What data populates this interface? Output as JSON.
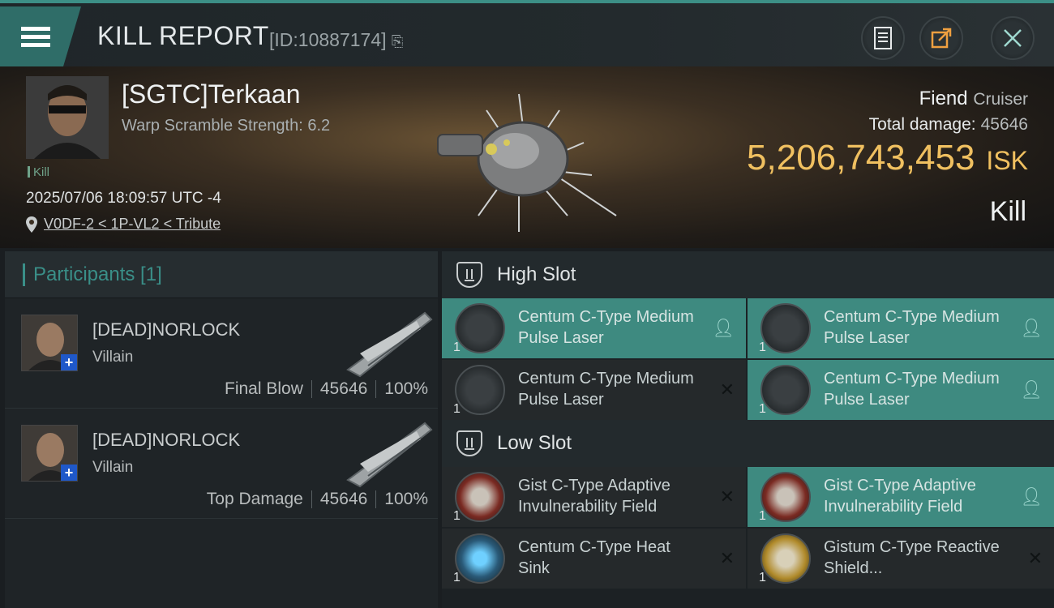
{
  "header": {
    "title": "KILL REPORT",
    "kill_id": "[ID:10887174]"
  },
  "victim": {
    "name": "[SGTC]Terkaan",
    "warp_scramble": "Warp Scramble Strength: 6.2",
    "tag": "Kill",
    "datetime": "2025/07/06 18:09:57 UTC -4",
    "location": "V0DF-2 < 1P-VL2 < Tribute",
    "ship_name": "Fiend",
    "ship_class": "Cruiser",
    "total_damage_label": "Total damage:",
    "total_damage": "45646",
    "isk_value": "5,206,743,453",
    "isk_unit": "ISK",
    "result": "Kill"
  },
  "participants": {
    "header": "Participants [1]",
    "rows": [
      {
        "name": "[DEAD]NORLOCK",
        "corp": "Villain",
        "role": "Final Blow",
        "damage": "45646",
        "percent": "100%"
      },
      {
        "name": "[DEAD]NORLOCK",
        "corp": "Villain",
        "role": "Top Damage",
        "damage": "45646",
        "percent": "100%"
      }
    ]
  },
  "slots": {
    "high": {
      "label": "High Slot",
      "items": [
        {
          "name": "Centum C-Type Medium Pulse Laser",
          "qty": "1",
          "status": "dropped"
        },
        {
          "name": "Centum C-Type Medium Pulse Laser",
          "qty": "1",
          "status": "dropped"
        },
        {
          "name": "Centum C-Type Medium Pulse Laser",
          "qty": "1",
          "status": "destroyed"
        },
        {
          "name": "Centum C-Type Medium Pulse Laser",
          "qty": "1",
          "status": "dropped"
        }
      ]
    },
    "low": {
      "label": "Low Slot",
      "items": [
        {
          "name": "Gist C-Type Adaptive Invulnerability Field",
          "qty": "1",
          "status": "destroyed"
        },
        {
          "name": "Gist C-Type Adaptive Invulnerability Field",
          "qty": "1",
          "status": "dropped"
        },
        {
          "name": "Centum C-Type Heat Sink",
          "qty": "1",
          "status": "destroyed"
        },
        {
          "name": "Gistum C-Type Reactive Shield...",
          "qty": "1",
          "status": "destroyed"
        }
      ]
    }
  },
  "colors": {
    "accent": "#3a8f88",
    "isk": "#f0c060",
    "dropped_bg": "#3e8a80"
  }
}
